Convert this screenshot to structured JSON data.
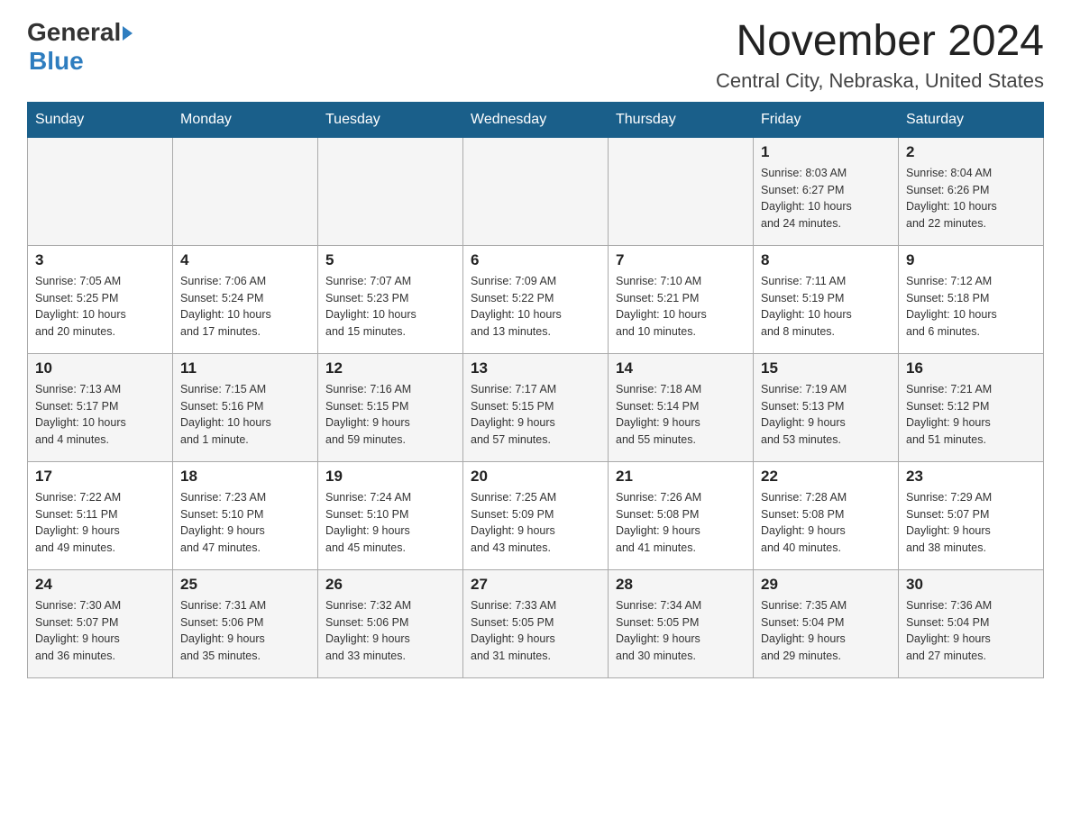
{
  "header": {
    "logo_general": "General",
    "logo_blue": "Blue",
    "month_title": "November 2024",
    "location": "Central City, Nebraska, United States"
  },
  "days_of_week": [
    "Sunday",
    "Monday",
    "Tuesday",
    "Wednesday",
    "Thursday",
    "Friday",
    "Saturday"
  ],
  "weeks": [
    {
      "days": [
        {
          "number": "",
          "info": ""
        },
        {
          "number": "",
          "info": ""
        },
        {
          "number": "",
          "info": ""
        },
        {
          "number": "",
          "info": ""
        },
        {
          "number": "",
          "info": ""
        },
        {
          "number": "1",
          "info": "Sunrise: 8:03 AM\nSunset: 6:27 PM\nDaylight: 10 hours\nand 24 minutes."
        },
        {
          "number": "2",
          "info": "Sunrise: 8:04 AM\nSunset: 6:26 PM\nDaylight: 10 hours\nand 22 minutes."
        }
      ]
    },
    {
      "days": [
        {
          "number": "3",
          "info": "Sunrise: 7:05 AM\nSunset: 5:25 PM\nDaylight: 10 hours\nand 20 minutes."
        },
        {
          "number": "4",
          "info": "Sunrise: 7:06 AM\nSunset: 5:24 PM\nDaylight: 10 hours\nand 17 minutes."
        },
        {
          "number": "5",
          "info": "Sunrise: 7:07 AM\nSunset: 5:23 PM\nDaylight: 10 hours\nand 15 minutes."
        },
        {
          "number": "6",
          "info": "Sunrise: 7:09 AM\nSunset: 5:22 PM\nDaylight: 10 hours\nand 13 minutes."
        },
        {
          "number": "7",
          "info": "Sunrise: 7:10 AM\nSunset: 5:21 PM\nDaylight: 10 hours\nand 10 minutes."
        },
        {
          "number": "8",
          "info": "Sunrise: 7:11 AM\nSunset: 5:19 PM\nDaylight: 10 hours\nand 8 minutes."
        },
        {
          "number": "9",
          "info": "Sunrise: 7:12 AM\nSunset: 5:18 PM\nDaylight: 10 hours\nand 6 minutes."
        }
      ]
    },
    {
      "days": [
        {
          "number": "10",
          "info": "Sunrise: 7:13 AM\nSunset: 5:17 PM\nDaylight: 10 hours\nand 4 minutes."
        },
        {
          "number": "11",
          "info": "Sunrise: 7:15 AM\nSunset: 5:16 PM\nDaylight: 10 hours\nand 1 minute."
        },
        {
          "number": "12",
          "info": "Sunrise: 7:16 AM\nSunset: 5:15 PM\nDaylight: 9 hours\nand 59 minutes."
        },
        {
          "number": "13",
          "info": "Sunrise: 7:17 AM\nSunset: 5:15 PM\nDaylight: 9 hours\nand 57 minutes."
        },
        {
          "number": "14",
          "info": "Sunrise: 7:18 AM\nSunset: 5:14 PM\nDaylight: 9 hours\nand 55 minutes."
        },
        {
          "number": "15",
          "info": "Sunrise: 7:19 AM\nSunset: 5:13 PM\nDaylight: 9 hours\nand 53 minutes."
        },
        {
          "number": "16",
          "info": "Sunrise: 7:21 AM\nSunset: 5:12 PM\nDaylight: 9 hours\nand 51 minutes."
        }
      ]
    },
    {
      "days": [
        {
          "number": "17",
          "info": "Sunrise: 7:22 AM\nSunset: 5:11 PM\nDaylight: 9 hours\nand 49 minutes."
        },
        {
          "number": "18",
          "info": "Sunrise: 7:23 AM\nSunset: 5:10 PM\nDaylight: 9 hours\nand 47 minutes."
        },
        {
          "number": "19",
          "info": "Sunrise: 7:24 AM\nSunset: 5:10 PM\nDaylight: 9 hours\nand 45 minutes."
        },
        {
          "number": "20",
          "info": "Sunrise: 7:25 AM\nSunset: 5:09 PM\nDaylight: 9 hours\nand 43 minutes."
        },
        {
          "number": "21",
          "info": "Sunrise: 7:26 AM\nSunset: 5:08 PM\nDaylight: 9 hours\nand 41 minutes."
        },
        {
          "number": "22",
          "info": "Sunrise: 7:28 AM\nSunset: 5:08 PM\nDaylight: 9 hours\nand 40 minutes."
        },
        {
          "number": "23",
          "info": "Sunrise: 7:29 AM\nSunset: 5:07 PM\nDaylight: 9 hours\nand 38 minutes."
        }
      ]
    },
    {
      "days": [
        {
          "number": "24",
          "info": "Sunrise: 7:30 AM\nSunset: 5:07 PM\nDaylight: 9 hours\nand 36 minutes."
        },
        {
          "number": "25",
          "info": "Sunrise: 7:31 AM\nSunset: 5:06 PM\nDaylight: 9 hours\nand 35 minutes."
        },
        {
          "number": "26",
          "info": "Sunrise: 7:32 AM\nSunset: 5:06 PM\nDaylight: 9 hours\nand 33 minutes."
        },
        {
          "number": "27",
          "info": "Sunrise: 7:33 AM\nSunset: 5:05 PM\nDaylight: 9 hours\nand 31 minutes."
        },
        {
          "number": "28",
          "info": "Sunrise: 7:34 AM\nSunset: 5:05 PM\nDaylight: 9 hours\nand 30 minutes."
        },
        {
          "number": "29",
          "info": "Sunrise: 7:35 AM\nSunset: 5:04 PM\nDaylight: 9 hours\nand 29 minutes."
        },
        {
          "number": "30",
          "info": "Sunrise: 7:36 AM\nSunset: 5:04 PM\nDaylight: 9 hours\nand 27 minutes."
        }
      ]
    }
  ]
}
